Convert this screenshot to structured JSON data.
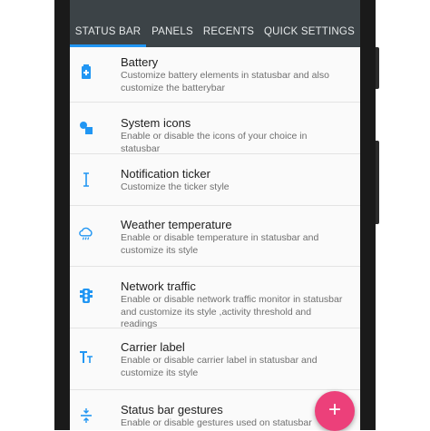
{
  "tabs": [
    {
      "label": "STATUS BAR",
      "active": true
    },
    {
      "label": "PANELS",
      "active": false
    },
    {
      "label": "RECENTS",
      "active": false
    },
    {
      "label": "QUICK SETTINGS",
      "active": false
    }
  ],
  "items": [
    {
      "title": "Battery",
      "subtitle": "Customize battery elements in statusbar and also customize the batterybar",
      "icon": "battery-icon"
    },
    {
      "title": "System icons",
      "subtitle": "Enable or disable the icons of your choice in statusbar",
      "icon": "shapes-icon"
    },
    {
      "title": "Notification ticker",
      "subtitle": "Customize the ticker style",
      "icon": "text-cursor-icon"
    },
    {
      "title": "Weather temperature",
      "subtitle": "Enable or disable temperature in statusbar and customize its style",
      "icon": "weather-cloud-icon"
    },
    {
      "title": "Network traffic",
      "subtitle": "Enable or disable network traffic monitor in statusbar and customize its style ,activity threshold and readings",
      "icon": "traffic-light-icon"
    },
    {
      "title": "Carrier label",
      "subtitle": "Enable or disable carrier label in statusbar and customize its style",
      "icon": "text-format-icon"
    },
    {
      "title": "Status bar gestures",
      "subtitle": "Enable or disable gestures used on statusbar",
      "icon": "gesture-icon"
    }
  ],
  "fab": {
    "label": "+",
    "icon": "add-icon"
  },
  "colors": {
    "accent": "#2196f3",
    "toolbar": "#3c4347",
    "fab": "#ec407a"
  }
}
